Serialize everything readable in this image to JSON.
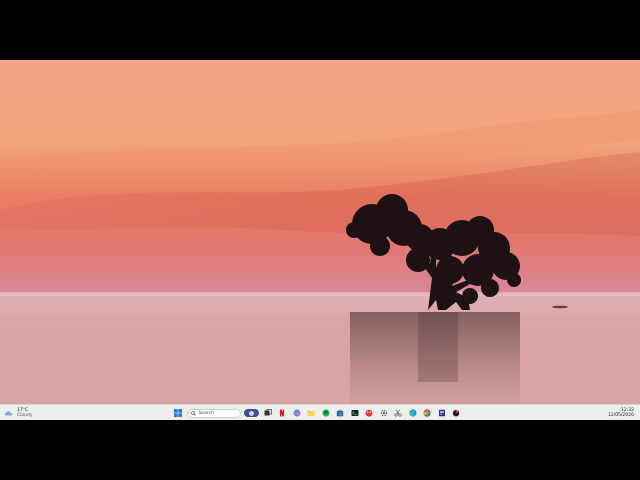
{
  "weather": {
    "temperature": "17°C",
    "condition": "Cloudy"
  },
  "search": {
    "label": "Search"
  },
  "taskbar_apps": [
    {
      "name": "start-button",
      "icon": "windows-logo"
    },
    {
      "name": "task-view-button",
      "icon": "task-view"
    },
    {
      "name": "netflix-app",
      "icon": "netflix"
    },
    {
      "name": "copilot-app",
      "icon": "copilot"
    },
    {
      "name": "file-explorer-app",
      "icon": "folder"
    },
    {
      "name": "spotify-app",
      "icon": "spotify"
    },
    {
      "name": "store-app",
      "icon": "store"
    },
    {
      "name": "terminal-app",
      "icon": "terminal"
    },
    {
      "name": "paint-app",
      "icon": "paint"
    },
    {
      "name": "settings-app",
      "icon": "gear"
    },
    {
      "name": "snipping-app",
      "icon": "scissors"
    },
    {
      "name": "edge-app",
      "icon": "edge"
    },
    {
      "name": "chrome-app",
      "icon": "chrome"
    },
    {
      "name": "notes-app",
      "icon": "notes"
    },
    {
      "name": "game-app",
      "icon": "game"
    }
  ],
  "clock": {
    "time": "12:32",
    "date": "12/05/2026"
  },
  "colors": {
    "taskbar": "#eeeeef",
    "sky_top": "#f6a889",
    "sky_mid": "#ec7f60",
    "sky_low": "#d9778b",
    "water": "#d9a5a7",
    "tree": "#1d1113"
  }
}
